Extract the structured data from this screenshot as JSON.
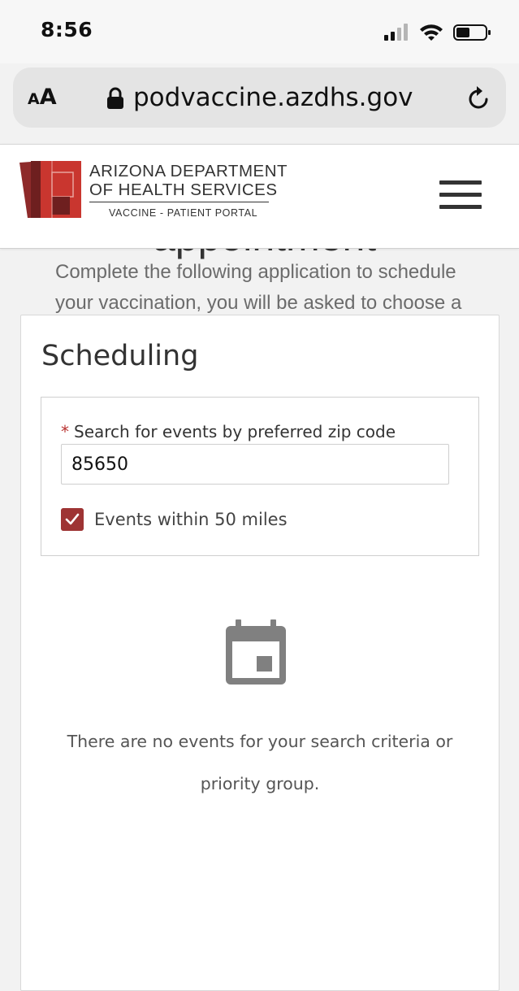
{
  "status_bar": {
    "time": "8:56"
  },
  "browser": {
    "text_size_small": "A",
    "text_size_large": "A",
    "url": "podvaccine.azdhs.gov"
  },
  "header": {
    "org_line1": "ARIZONA DEPARTMENT",
    "org_line2": "OF HEALTH SERVICES",
    "portal_name": "VACCINE - PATIENT PORTAL"
  },
  "background": {
    "heading_partial": "appointment",
    "intro_line1": "Complete the following application to schedule",
    "intro_line2": "your vaccination, you will be asked to choose a"
  },
  "scheduling": {
    "title": "Scheduling",
    "required_marker": "*",
    "zip_label": "Search for events by preferred zip code",
    "zip_value": "85650",
    "radius_label": "Events within 50 miles",
    "radius_checked": true,
    "empty_message_line1": "There are no events for your search criteria or",
    "empty_message_line2": "priority group."
  },
  "colors": {
    "brand_red": "#9e3434",
    "required_red": "#b8312f",
    "icon_gray": "#808080"
  }
}
